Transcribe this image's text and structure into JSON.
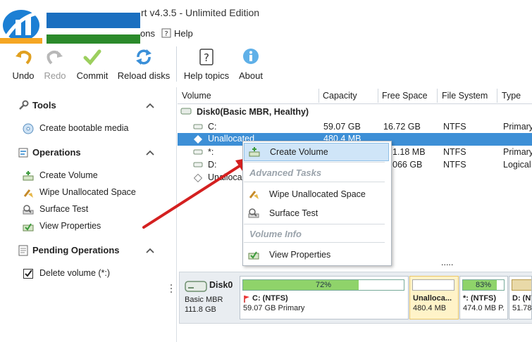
{
  "window": {
    "title": "rt v4.3.5 - Unlimited Edition"
  },
  "menu": {
    "items": [
      "ons",
      "Help"
    ]
  },
  "toolbar": {
    "undo": "Undo",
    "redo": "Redo",
    "commit": "Commit",
    "reload": "Reload disks",
    "help_topics": "Help topics",
    "about": "About"
  },
  "left_panel": {
    "tools": {
      "title": "Tools",
      "items": [
        "Create bootable media"
      ]
    },
    "operations": {
      "title": "Operations",
      "items": [
        "Create Volume",
        "Wipe Unallocated Space",
        "Surface Test",
        "View Properties"
      ]
    },
    "pending": {
      "title": "Pending Operations",
      "items": [
        "Delete volume (*:)"
      ]
    }
  },
  "grid": {
    "columns": [
      "Volume",
      "Capacity",
      "Free Space",
      "File System",
      "Type"
    ],
    "disk_label": "Disk0(Basic MBR, Healthy)",
    "rows": [
      {
        "volume": "C:",
        "capacity": "59.07 GB",
        "free": "16.72 GB",
        "fs": "NTFS",
        "type": "Primary"
      },
      {
        "volume": "Unallocated",
        "capacity": "480.4 MB",
        "free": "",
        "fs": "",
        "type": ""
      },
      {
        "volume": "*:",
        "capacity": "",
        "free": "1.18 MB",
        "fs": "NTFS",
        "type": "Primary"
      },
      {
        "volume": "D:",
        "capacity": "",
        "free": "066 GB",
        "fs": "NTFS",
        "type": "Logical"
      },
      {
        "volume": "Unalloca",
        "capacity": "",
        "free": "",
        "fs": "",
        "type": ""
      }
    ],
    "more": "....."
  },
  "context_menu": {
    "create_volume": "Create Volume",
    "advanced_head": "Advanced Tasks",
    "wipe": "Wipe Unallocated Space",
    "surface": "Surface Test",
    "info_head": "Volume Info",
    "properties": "View Properties"
  },
  "disk_map": {
    "disk": {
      "name": "Disk0",
      "type": "Basic MBR",
      "size": "111.8 GB"
    },
    "partitions": [
      {
        "name": "C: (NTFS)",
        "detail": "59.07 GB Primary",
        "used_percent": 72,
        "pct_label": "72%"
      },
      {
        "name": "Unalloca...",
        "detail": "480.4 MB",
        "used_percent": 0
      },
      {
        "name": "*: (NTFS)",
        "detail": "474.0 MB P.",
        "used_percent": 83,
        "pct_label": "83%"
      },
      {
        "name": "D: (NT",
        "detail": "51.78"
      }
    ]
  },
  "colors": {
    "selection": "#3d8fd6",
    "highlight": "#cfe5f8",
    "accent_arrow": "#d42020",
    "used_bar": "#8fd36a",
    "unalloc": "#fff3c8"
  }
}
